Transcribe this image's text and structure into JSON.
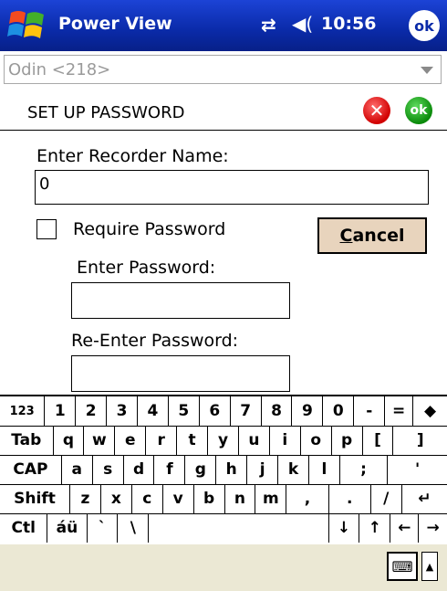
{
  "titlebar": {
    "app_title": "Power View",
    "clock": "10:56",
    "ok_label": "ok",
    "sync_icon": "⇄",
    "volume_icon": "◀("
  },
  "combo": {
    "value": "Odin <218>"
  },
  "header": {
    "title": "SET UP PASSWORD",
    "cancel_icon": "✕",
    "ok_icon": "ok"
  },
  "form": {
    "recorder_name_label": "Enter Recorder Name:",
    "recorder_name_value": "0",
    "require_password_label": "Require Password",
    "cancel_button_label_rest": "ancel",
    "cancel_button_label_mnemonic": "C",
    "enter_password_label": "Enter Password:",
    "reenter_password_label": "Re-Enter Password:"
  },
  "keyboard": {
    "row1": [
      "123",
      "1",
      "2",
      "3",
      "4",
      "5",
      "6",
      "7",
      "8",
      "9",
      "0",
      "-",
      "=",
      "◆"
    ],
    "row2": [
      "Tab",
      "q",
      "w",
      "e",
      "r",
      "t",
      "y",
      "u",
      "i",
      "o",
      "p",
      "[",
      "]"
    ],
    "row3": [
      "CAP",
      "a",
      "s",
      "d",
      "f",
      "g",
      "h",
      "j",
      "k",
      "l",
      ";",
      "'"
    ],
    "row4": [
      "Shift",
      "z",
      "x",
      "c",
      "v",
      "b",
      "n",
      "m",
      ",",
      ".",
      "/",
      "↵"
    ],
    "row5": [
      "Ctl",
      "áü",
      "`",
      "\\",
      "",
      "↓",
      "↑",
      "←",
      "→"
    ]
  },
  "bottombar": {
    "keyboard_icon": "⌨",
    "up_arrow": "▲"
  }
}
